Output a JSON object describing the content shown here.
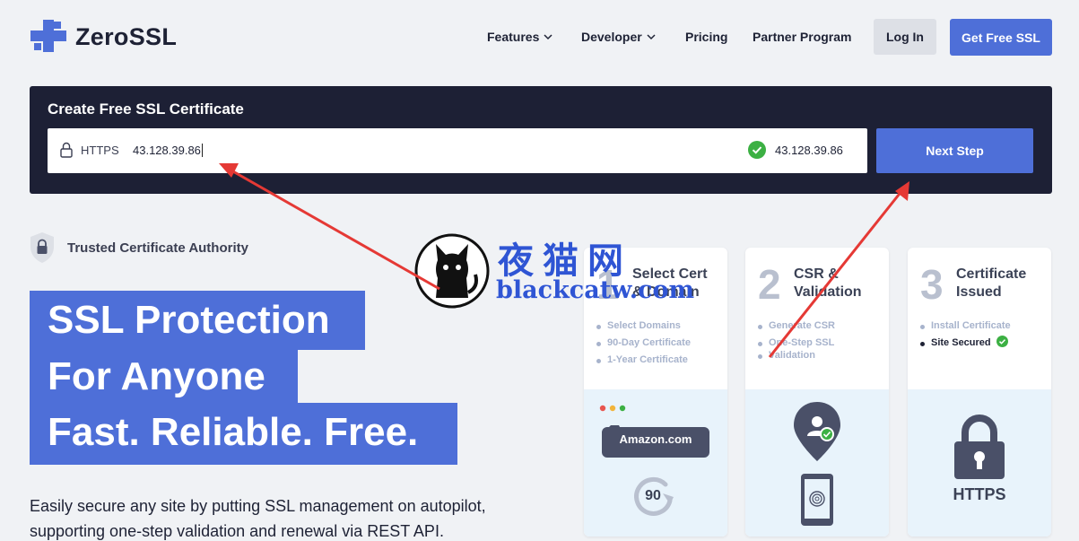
{
  "header": {
    "brand": "ZeroSSL",
    "nav": [
      {
        "label": "Features",
        "has_dropdown": true
      },
      {
        "label": "Developer",
        "has_dropdown": true
      },
      {
        "label": "Pricing",
        "has_dropdown": false
      },
      {
        "label": "Partner Program",
        "has_dropdown": false
      }
    ],
    "login_label": "Log In",
    "cta_label": "Get Free SSL"
  },
  "create": {
    "title": "Create Free SSL Certificate",
    "protocol": "HTTPS",
    "domain_value": "43.128.39.86",
    "validated_domain": "43.128.39.86",
    "next_label": "Next Step"
  },
  "trusted": {
    "label": "Trusted Certificate Authority"
  },
  "hero": {
    "line1": "SSL Protection",
    "line2": "For Anyone",
    "line3": "Fast. Reliable. Free.",
    "description": "Easily secure any site by putting SSL management on autopilot, supporting one-step validation and renewal via REST API."
  },
  "steps": [
    {
      "number": "1",
      "title_line1": "Select Cert",
      "title_line2": "& Domain",
      "items": [
        "Select Domains",
        "90-Day Certificate",
        "1-Year Certificate"
      ],
      "illustration": {
        "site_label": "Amazon.com",
        "days": "90"
      }
    },
    {
      "number": "2",
      "title_line1": "CSR &",
      "title_line2": "Validation",
      "items": [
        "Generate CSR",
        "One-Step SSL",
        "Validation"
      ]
    },
    {
      "number": "3",
      "title_line1": "Certificate",
      "title_line2": "Issued",
      "items": [
        "Install Certificate",
        "Site Secured"
      ],
      "illustration": {
        "lock_label": "HTTPS"
      }
    }
  ],
  "watermark": {
    "cn": "夜猫网",
    "en": "blackcatw.com"
  },
  "colors": {
    "accent": "#4e6fd8",
    "dark_panel": "#1d2035",
    "success": "#3cb043",
    "annotation": "#e53935"
  }
}
